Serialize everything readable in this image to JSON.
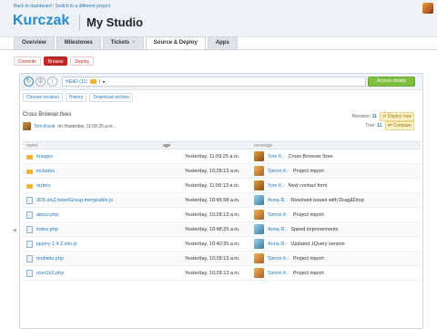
{
  "top": {
    "link_dashboard": "Back to dashboard",
    "link_separator": "|",
    "link_switch": "Switch to a different project",
    "brand": "Kurczak",
    "project": "My Studio"
  },
  "tabs": [
    {
      "label": "Overview"
    },
    {
      "label": "Milestones"
    },
    {
      "label": "Tickets",
      "extra": "+"
    },
    {
      "label": "Source & Deploy"
    },
    {
      "label": "Apps"
    }
  ],
  "subtabs": [
    {
      "label": "Commits"
    },
    {
      "label": "Browse"
    },
    {
      "label": "Deploy"
    }
  ],
  "toolbar": {
    "head_label": "HEAD (11)",
    "path": "/",
    "access_details": "Access details"
  },
  "links": {
    "choose_revision": "Choose revision",
    "history": "History",
    "download_archive": "Download archive"
  },
  "commit": {
    "title": "Cross Browser fixes",
    "author": "Tom Koval",
    "when": "on Yesterday, 11:09:25 a.m.",
    "revision_label": "Revision:",
    "revision": "11",
    "deploy_now": "Deploy now",
    "tree_label": "Tree:",
    "tree": "11",
    "compare": "Compare"
  },
  "table": {
    "headers": [
      "name",
      "age",
      "message"
    ],
    "rows": [
      {
        "type": "dir",
        "name": "images",
        "age": "Yesterday, 11:09:25 a.m.",
        "author": "Tom K.:",
        "msg": "Cross Browser fixes",
        "av": "tom"
      },
      {
        "type": "dir",
        "name": "includes",
        "age": "Yesterday, 10:28:13 a.m.",
        "author": "Simon K.:",
        "msg": "Project import",
        "av": "simon"
      },
      {
        "type": "dir",
        "name": "orders",
        "age": "Yesterday, 11:06:13 a.m.",
        "author": "Tom K.:",
        "msg": "New contact form",
        "av": "tom"
      },
      {
        "type": "file",
        "name": "3D5.sls2.ticketGroup.mergeable.js",
        "age": "Yesterday, 10:45:58 a.m.",
        "author": "Anna R.:",
        "msg": "Resolved issues with Drag&Drop",
        "av": "anna"
      },
      {
        "type": "file",
        "name": "about.php",
        "age": "Yesterday, 10:28:13 a.m.",
        "author": "Simon K.:",
        "msg": "Project import",
        "av": "simon"
      },
      {
        "type": "file",
        "name": "index.php",
        "age": "Yesterday, 10:48:29 a.m.",
        "author": "Anna R.:",
        "msg": "Speed improvements",
        "av": "anna"
      },
      {
        "type": "file",
        "name": "jquery-1.4.2.min.js",
        "age": "Yesterday, 10:40:25 a.m.",
        "author": "Anna R.:",
        "msg": "Updated JQuery version",
        "av": "anna"
      },
      {
        "type": "file",
        "name": "mobiele.php",
        "age": "Yesterday, 10:28:13 a.m.",
        "author": "Simon K.:",
        "msg": "Project import",
        "av": "simon"
      },
      {
        "type": "file",
        "name": "over2x2.php",
        "age": "Yesterday, 10:28:13 a.m.",
        "author": "Simon K.:",
        "msg": "Project import",
        "av": "simon"
      }
    ]
  }
}
